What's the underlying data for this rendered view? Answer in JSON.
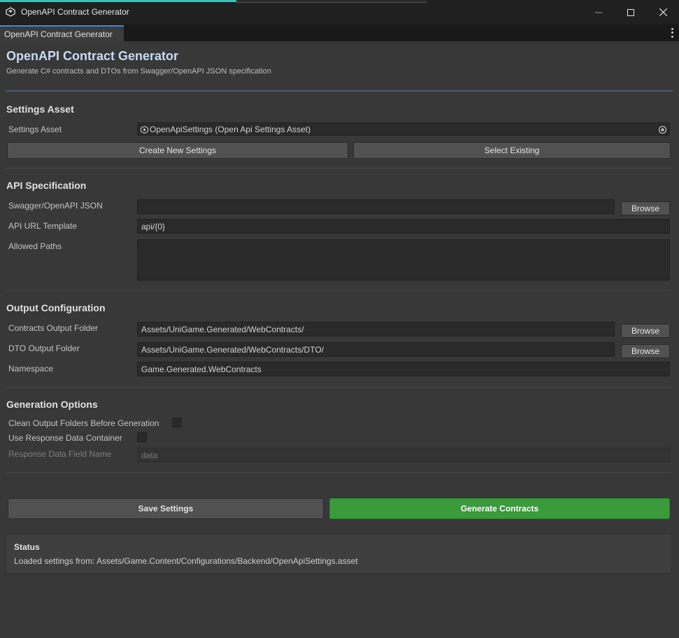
{
  "window": {
    "title": "OpenAPI Contract Generator",
    "tab_label": "OpenAPI Contract Generator"
  },
  "header": {
    "title": "OpenAPI Contract Generator",
    "subtitle": "Generate C# contracts and DTOs from Swagger/OpenAPI JSON specification"
  },
  "settings_asset": {
    "section_title": "Settings Asset",
    "label": "Settings Asset",
    "value": "OpenApiSettings (Open Api Settings Asset)",
    "create_button": "Create New Settings",
    "select_button": "Select Existing"
  },
  "api_spec": {
    "section_title": "API Specification",
    "json_label": "Swagger/OpenAPI JSON",
    "json_value": "",
    "browse_label": "Browse",
    "url_label": "API URL Template",
    "url_value": "api/{0}",
    "paths_label": "Allowed Paths",
    "paths_value": ""
  },
  "output": {
    "section_title": "Output Configuration",
    "contracts_label": "Contracts Output Folder",
    "contracts_value": "Assets/UniGame.Generated/WebContracts/",
    "dto_label": "DTO Output Folder",
    "dto_value": "Assets/UniGame.Generated/WebContracts/DTO/",
    "namespace_label": "Namespace",
    "namespace_value": "Game.Generated.WebContracts",
    "browse_label": "Browse"
  },
  "generation": {
    "section_title": "Generation Options",
    "clean_label": "Clean Output Folders Before Generation",
    "clean_checked": false,
    "container_label": "Use Response Data Container",
    "container_checked": false,
    "field_name_label": "Response Data Field Name",
    "field_name_value": "data"
  },
  "actions": {
    "save_label": "Save Settings",
    "generate_label": "Generate Contracts"
  },
  "status": {
    "title": "Status",
    "text": "Loaded settings from: Assets/Game.Content/Configurations/Backend/OpenApiSettings.asset"
  },
  "colors": {
    "accent_teal": "#2ec4b6",
    "title_blue": "#c6dcf5",
    "generate_green": "#3a9a3c",
    "background": "#383838"
  }
}
